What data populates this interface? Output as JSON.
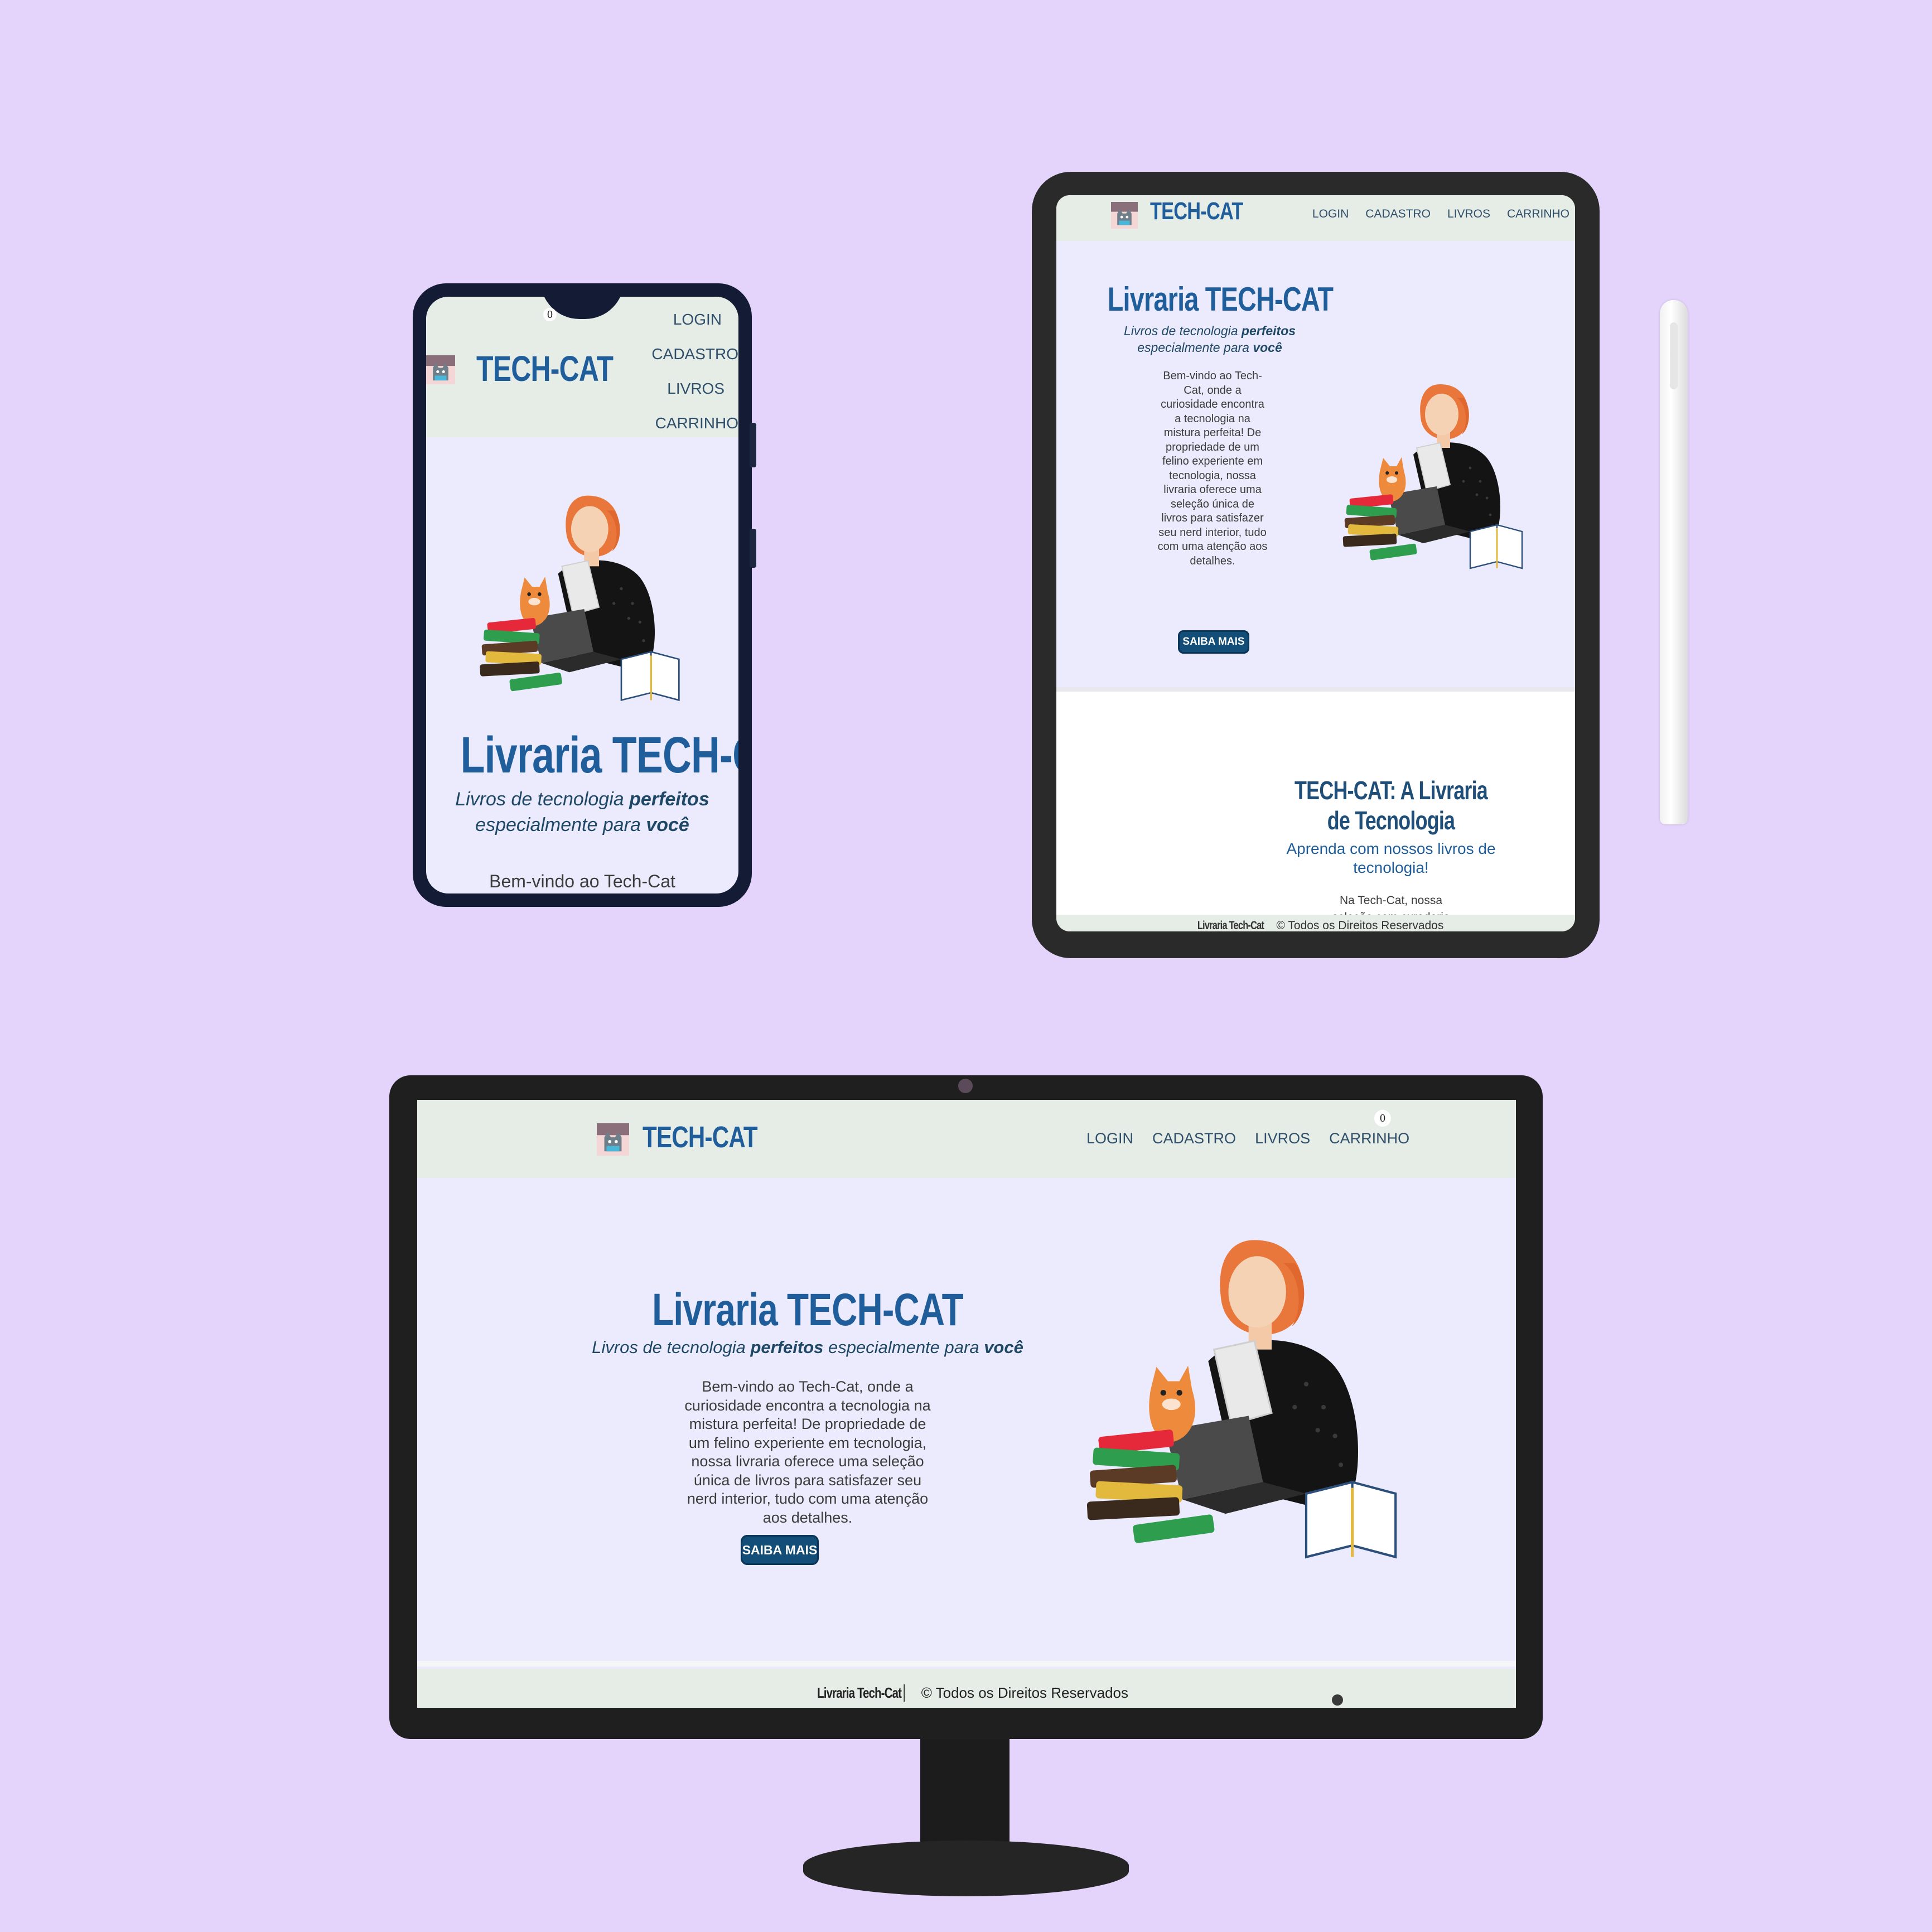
{
  "site": {
    "brand": "TECH-CAT",
    "nav": [
      "LOGIN",
      "CADASTRO",
      "LIVROS",
      "CARRINHO"
    ],
    "cart_count": "0",
    "hero_title": "Livraria TECH-CAT",
    "hero_subtitle_parts": [
      "Livros de tecnologia ",
      "perfeitos",
      " especialmente para ",
      "você"
    ],
    "hero_body": "Bem-vindo ao Tech-Cat, onde a curiosidade encontra a tecnologia na mistura perfeita! De propriedade de um felino experiente em tecnologia, nossa livraria oferece uma seleção única de livros para satisfazer seu nerd interior, tudo com uma atenção aos detalhes.",
    "hero_button": "SAIBA MAIS",
    "section_title": "TECH-CAT: A Livraria de Tecnologia",
    "section_subtitle": "Aprenda com nossos livros de tecnologia!",
    "section_body": "Na Tech-Cat, nossa seleção com curadoria",
    "footer_brand": "Livraria Tech-Cat",
    "footer_text": "© Todos os Direitos Reservados",
    "phone_body_peek": "Bem-vindo ao Tech-Cat"
  },
  "colors": {
    "background": "#e4d4fc",
    "header": "#e6ece6",
    "hero": "#ebebfd",
    "brand": "#1f5e9b",
    "button": "#124e78"
  },
  "icons": [
    "cat-logo-icon",
    "reader-illustration",
    "camera-icon",
    "power-led-icon",
    "stylus-icon"
  ]
}
